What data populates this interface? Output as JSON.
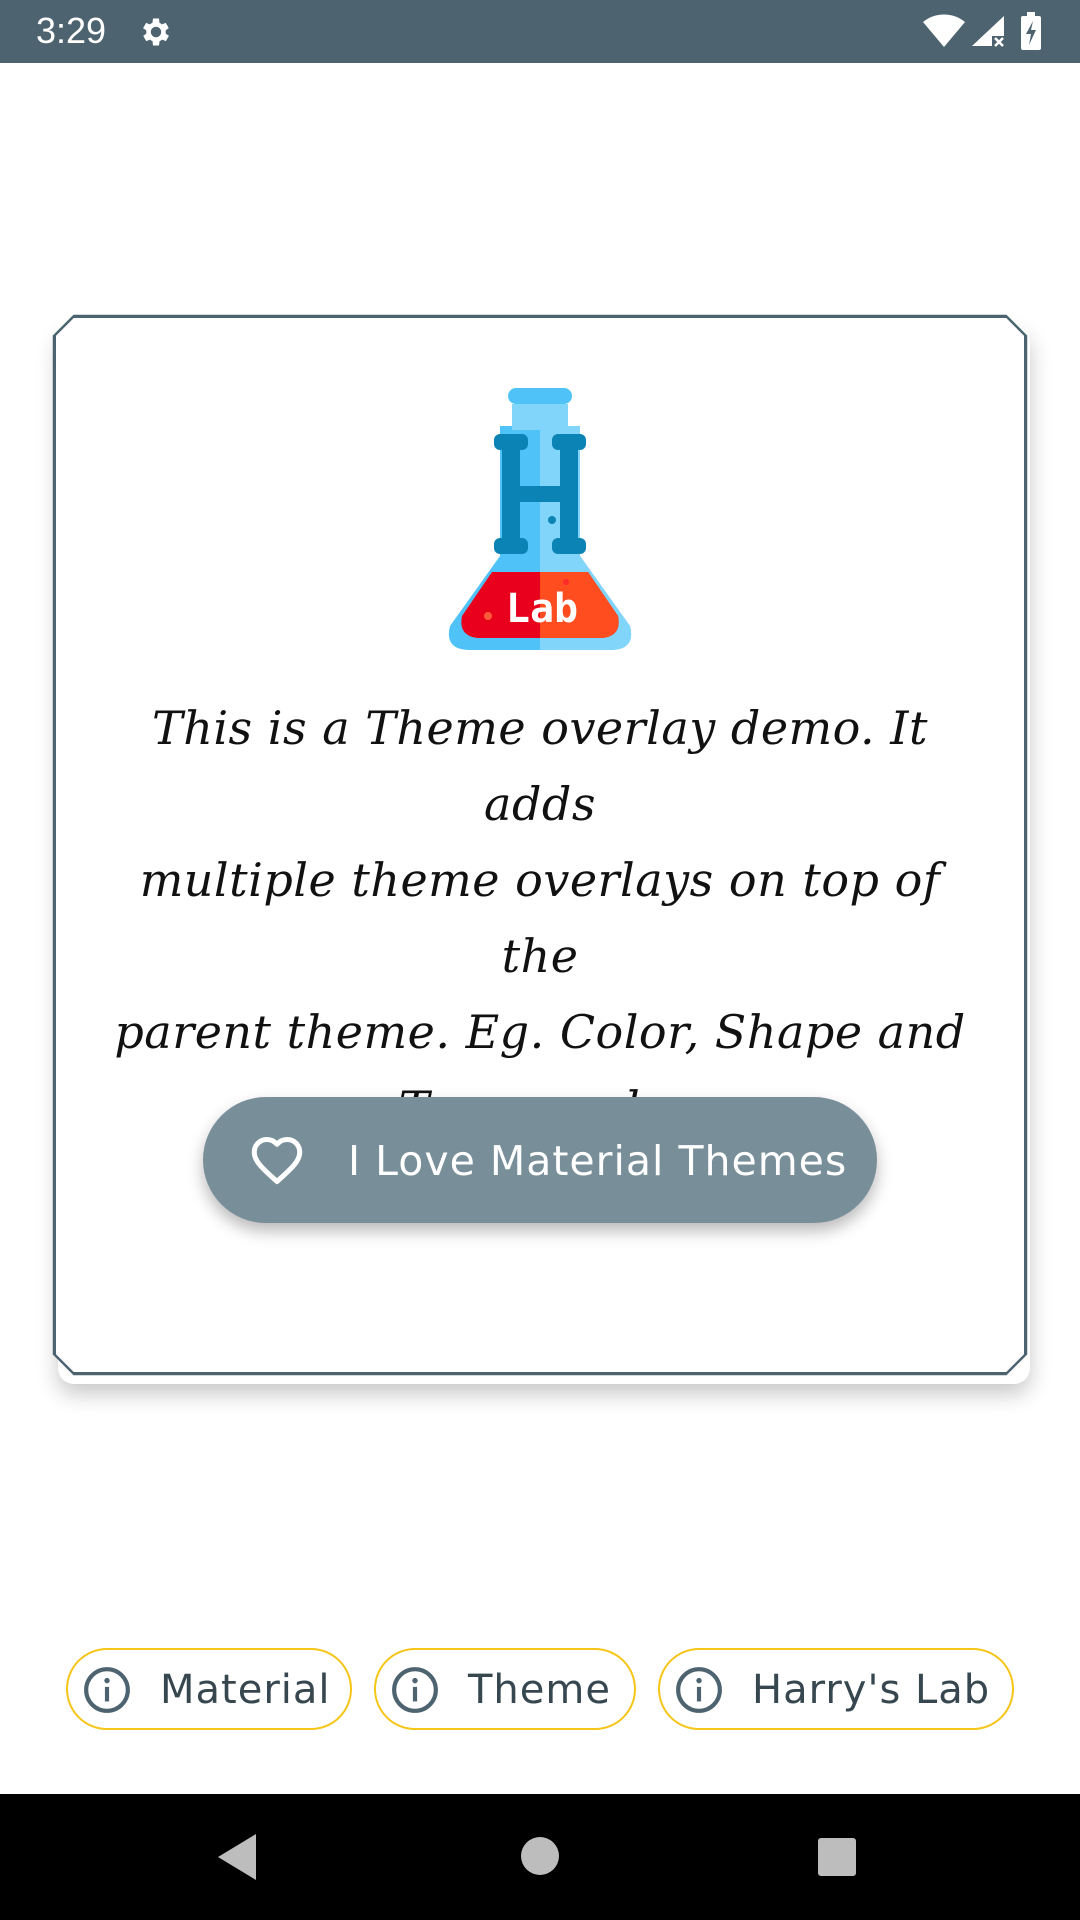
{
  "status_bar": {
    "time": "3:29",
    "icons": [
      "gear-icon",
      "wifi-icon",
      "cell-signal-icon",
      "battery-charging-icon"
    ]
  },
  "card": {
    "logo": {
      "letter": "H",
      "label": "Lab"
    },
    "description": "This is a Theme overlay demo. It adds multiple theme overlays on top of the parent theme. Eg. Color, Shape and Typography",
    "description_lines": [
      "This is a Theme overlay demo. It adds",
      "multiple theme overlays on top of the",
      "parent theme. Eg. Color, Shape and",
      "Typography"
    ],
    "button": {
      "label": "I Love Material Themes",
      "icon": "heart-outline-icon"
    }
  },
  "chips": [
    {
      "label": "Material",
      "icon": "info-icon"
    },
    {
      "label": "Theme",
      "icon": "info-icon"
    },
    {
      "label": "Harry's Lab",
      "icon": "info-icon"
    }
  ],
  "nav_bar": {
    "icons": [
      "back-icon",
      "home-icon",
      "recents-icon"
    ]
  },
  "colors": {
    "status_bar": "#4d6470",
    "button": "#788f9a",
    "chip_border": "#f5c518",
    "card_border": "#4d6470",
    "nav_bar": "#000000"
  }
}
